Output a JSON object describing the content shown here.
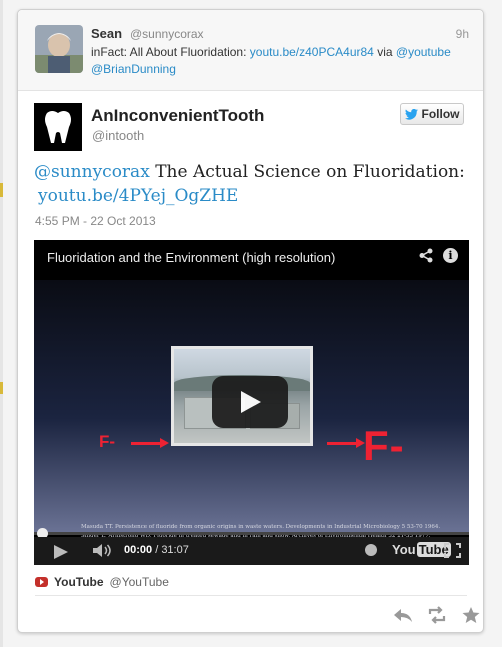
{
  "parent_tweet": {
    "name": "Sean",
    "handle": "@sunnycorax",
    "time": "9h",
    "text_prefix": "inFact: All About Fluoridation:",
    "link": "youtu.be/z40PCA4ur84",
    "via": "via",
    "mention_youtube": "@youtube",
    "mention_brian": "@BrianDunning"
  },
  "tweet": {
    "name": "AnInconvenientTooth",
    "handle": "@intooth",
    "follow_label": "Follow",
    "mention": "@sunnycorax",
    "text": "The Actual Science on Fluoridation:",
    "link": "youtu.be/4PYej_OgZHE",
    "timestamp": "4:55 PM - 22 Oct 2013"
  },
  "video": {
    "title": "Fluoridation and the Environment (high resolution)",
    "slide_left": "F-",
    "slide_right": "F-",
    "ref1": "Masuda TT. Persistence of fluoride from organic origins in waste waters. Developments in Industrial Microbiology 5 53-70 1964.",
    "ref2": "Singer L, Armstrong WD. Fluoride in treated sewage and in rain and snow. Archives of Environmental Health 32 21-33 1977.",
    "time_current": "00:00",
    "time_sep": " / ",
    "time_total": "31:07",
    "progress": 0,
    "yt_logo_you": "You",
    "yt_logo_tube": "Tube"
  },
  "attribution": {
    "name": "YouTube",
    "handle": "@YouTube"
  },
  "colors": {
    "link": "#2a8bc7",
    "accent_red": "#e22233",
    "yt_red": "#c4302b"
  },
  "icons": [
    "share-icon",
    "info-icon",
    "play-icon",
    "volume-icon",
    "watch-later-icon",
    "fullscreen-icon",
    "reply-icon",
    "retweet-icon",
    "favorite-icon"
  ]
}
